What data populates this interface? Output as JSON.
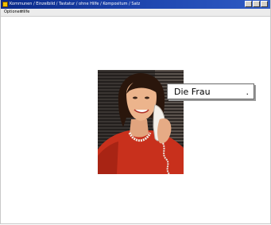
{
  "window": {
    "title": "Kommunen / Einzelbild / Tastatur / ohne Hilfe / Kompositum / Satz"
  },
  "menu": {
    "items": [
      "Optionen",
      "Hilfe"
    ]
  },
  "main": {
    "label_text": "Die Frau",
    "label_trailing": "."
  }
}
